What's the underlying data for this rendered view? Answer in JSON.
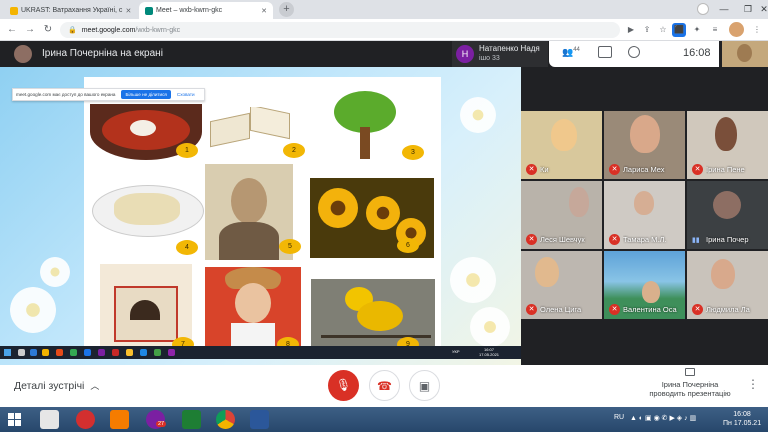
{
  "browser": {
    "tabs": [
      {
        "label": "UKRAST: Ватрахання Україні, с",
        "active": false
      },
      {
        "label": "Meet – wxb-kwrn-gkc",
        "active": true
      }
    ],
    "url": {
      "host": "meet.google.com",
      "path": "/wxb-kwrn-gkc"
    }
  },
  "meet": {
    "presenter_title": "Ірина Почерніна на екрані",
    "active_speaker": {
      "initial": "H",
      "name": "Натапенко Надя",
      "sub": "ішо 33"
    },
    "participants_count": "44",
    "time": "16:08"
  },
  "permission_banner": {
    "text": "meet.google.com має доступ до вашого екрана",
    "stop_label": "Більше не ділитися",
    "hide_label": "Сховати"
  },
  "slide_items": [
    {
      "num": "1",
      "subject": "borscht-bowl"
    },
    {
      "num": "2",
      "subject": "open-book"
    },
    {
      "num": "3",
      "subject": "tree"
    },
    {
      "num": "4",
      "subject": "dumplings-plate"
    },
    {
      "num": "5",
      "subject": "writer-portrait"
    },
    {
      "num": "6",
      "subject": "sunflowers"
    },
    {
      "num": "7",
      "subject": "painted-stove"
    },
    {
      "num": "8",
      "subject": "cossack-man"
    },
    {
      "num": "9",
      "subject": "canary-bird"
    }
  ],
  "inner_taskbar": {
    "time": "16:07",
    "date": "17.05.2021",
    "lang": "УКР"
  },
  "participants": [
    {
      "name": "Ки",
      "muted": true
    },
    {
      "name": "Лариса Мех",
      "muted": true
    },
    {
      "name": "Ірина Пене",
      "muted": true
    },
    {
      "name": "Леся Шевчук",
      "muted": true
    },
    {
      "name": "Тамара М.Л.",
      "muted": true
    },
    {
      "name": "Ірина Почер",
      "muted": false
    },
    {
      "name": "Олена Цига",
      "muted": true
    },
    {
      "name": "Валентина Оса",
      "muted": true
    },
    {
      "name": "Людмила Ла",
      "muted": true
    }
  ],
  "controls": {
    "details_label": "Деталі зустрічі",
    "presenting_line1": "Ірина Почерніна",
    "presenting_line2": "проводить презентацію"
  },
  "taskbar": {
    "lang": "RU",
    "time": "16:08",
    "date": "Пн 17.05.21",
    "viber_badge": "27"
  },
  "colors": {
    "meet_red": "#d93025",
    "meet_dark": "#202124",
    "badge_yellow": "#f2b705"
  }
}
